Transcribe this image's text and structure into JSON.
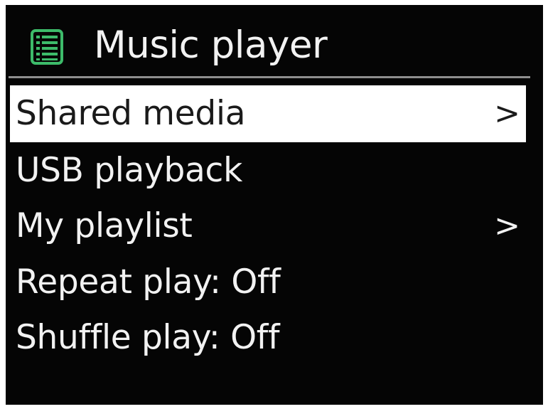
{
  "header": {
    "title": "Music player",
    "icon": "list-icon",
    "icon_color": "#3dbb6a"
  },
  "menu": {
    "items": [
      {
        "label": "Shared media",
        "chevron": ">",
        "selected": true
      },
      {
        "label": "USB playback",
        "chevron": "",
        "selected": false
      },
      {
        "label": "My playlist",
        "chevron": ">",
        "selected": false
      },
      {
        "label": "Repeat play: Off",
        "chevron": "",
        "selected": false
      },
      {
        "label": "Shuffle play: Off",
        "chevron": "",
        "selected": false
      }
    ]
  },
  "colors": {
    "background": "#050505",
    "text": "#f2f2f2",
    "highlight": "#ffffff",
    "highlight_text": "#1a1a1a"
  }
}
